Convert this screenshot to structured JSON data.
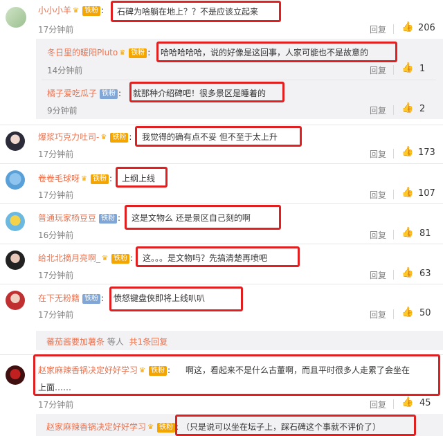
{
  "badges": {
    "gold": "铁粉",
    "iron": "铁粉"
  },
  "reply_label": "回复",
  "comments": [
    {
      "user": "小小小羊",
      "badge": "gold",
      "text": "石碑为啥躺在地上？？不是应该立起来",
      "time": "17分钟前",
      "likes": "206"
    },
    {
      "user": "冬日里的暖阳Pluto",
      "badge": "gold",
      "text": "哈哈哈哈哈，说的好像是这回事，人家可能也不是故意的",
      "time": "14分钟前",
      "likes": "1"
    },
    {
      "user": "橘子爱吃瓜子",
      "badge": "iron",
      "text": "就那种介绍碑吧！很多景区是睡着的",
      "time": "9分钟前",
      "likes": "2"
    },
    {
      "user": "爆浆巧克力吐司-",
      "badge": "gold",
      "text": "我觉得的确有点不妥 但不至于太上升",
      "time": "17分钟前",
      "likes": "173"
    },
    {
      "user": "卷卷毛球呀",
      "badge": "gold",
      "text": "上纲上线",
      "time": "17分钟前",
      "likes": "107"
    },
    {
      "user": "普通玩家杨豆豆",
      "badge": "iron",
      "text": "这是文物么 还是景区自己刻的啊",
      "time": "16分钟前",
      "likes": "81"
    },
    {
      "user": "给北北摘月亮啊_",
      "badge": "gold",
      "text": "这。。。是文物吗？先搞清楚再喷吧",
      "time": "17分钟前",
      "likes": "63"
    },
    {
      "user": "在下无粉籍",
      "badge": "iron",
      "text": "愤怒键盘侠即将上线叭叭",
      "time": "17分钟前",
      "likes": "50"
    },
    {
      "user": "赵家麻辣香锅决定好好学习",
      "badge": "gold",
      "text_line1": "啊这，看起来不是什么古董啊，而且平时很多人走累了会坐在",
      "text_line2": "上面……",
      "time": "17分钟前",
      "likes": "45"
    },
    {
      "user": "赵家麻辣香锅决定好好学习",
      "badge": "gold",
      "text": "（只是说可以坐在坛子上，踩石碑这个事就不评价了）"
    }
  ],
  "more_replies": {
    "users": "蕃茄酱要加薯条",
    "suffix": " 等人",
    "count_text": "共1条回复"
  },
  "colors": {
    "accent": "#eb7350",
    "highlight": "#e02020",
    "sub_bg": "#f2f2f5"
  }
}
